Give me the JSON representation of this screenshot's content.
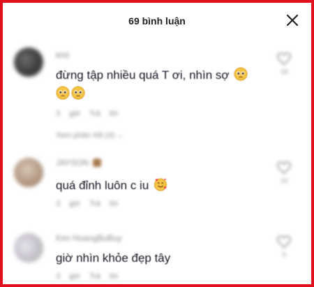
{
  "header": {
    "title": "69 bình luận"
  },
  "comments": [
    {
      "username": "khô",
      "text": "đừng tập nhiều quá T ơi, nhìn sợ",
      "time": "3 giờ",
      "reply": "Trả lời",
      "more_replies": "Xem phản hồi (4)",
      "likes": "18",
      "emoji": [
        "pleading-face-emoji",
        "pleading-face-emoji",
        "pleading-face-emoji"
      ]
    },
    {
      "username": "JAYSON",
      "text": "quá đỉnh luôn c iu",
      "time": "3 giờ",
      "reply": "Trả lời",
      "likes": "10",
      "emoji": [
        "smiling-face-with-hearts-emoji"
      ]
    },
    {
      "username": "Kim HoangBuBuy",
      "text": "giờ nhìn khỏe đẹp tây",
      "time": "3 giờ",
      "reply": "Trả lời",
      "likes": "5"
    }
  ],
  "colors": {
    "border": "#e2101e",
    "text": "#161823",
    "muted": "#8a8a8a"
  }
}
